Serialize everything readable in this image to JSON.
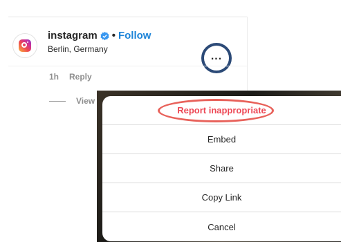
{
  "post": {
    "username": "instagram",
    "follow_label": "Follow",
    "separator": "•",
    "location": "Berlin, Germany",
    "more_label": "...",
    "time_ago": "1h",
    "reply_label": "Reply",
    "view_label": "View"
  },
  "menu": {
    "items": [
      {
        "label": "Report inappropriate",
        "style": "danger"
      },
      {
        "label": "Embed"
      },
      {
        "label": "Share"
      },
      {
        "label": "Copy Link"
      },
      {
        "label": "Cancel"
      }
    ]
  },
  "colors": {
    "follow": "#1d84d8",
    "danger": "#ed4956",
    "more_circle": "#2c4a77",
    "highlight": "#e8625b",
    "verified": "#3897f0"
  }
}
